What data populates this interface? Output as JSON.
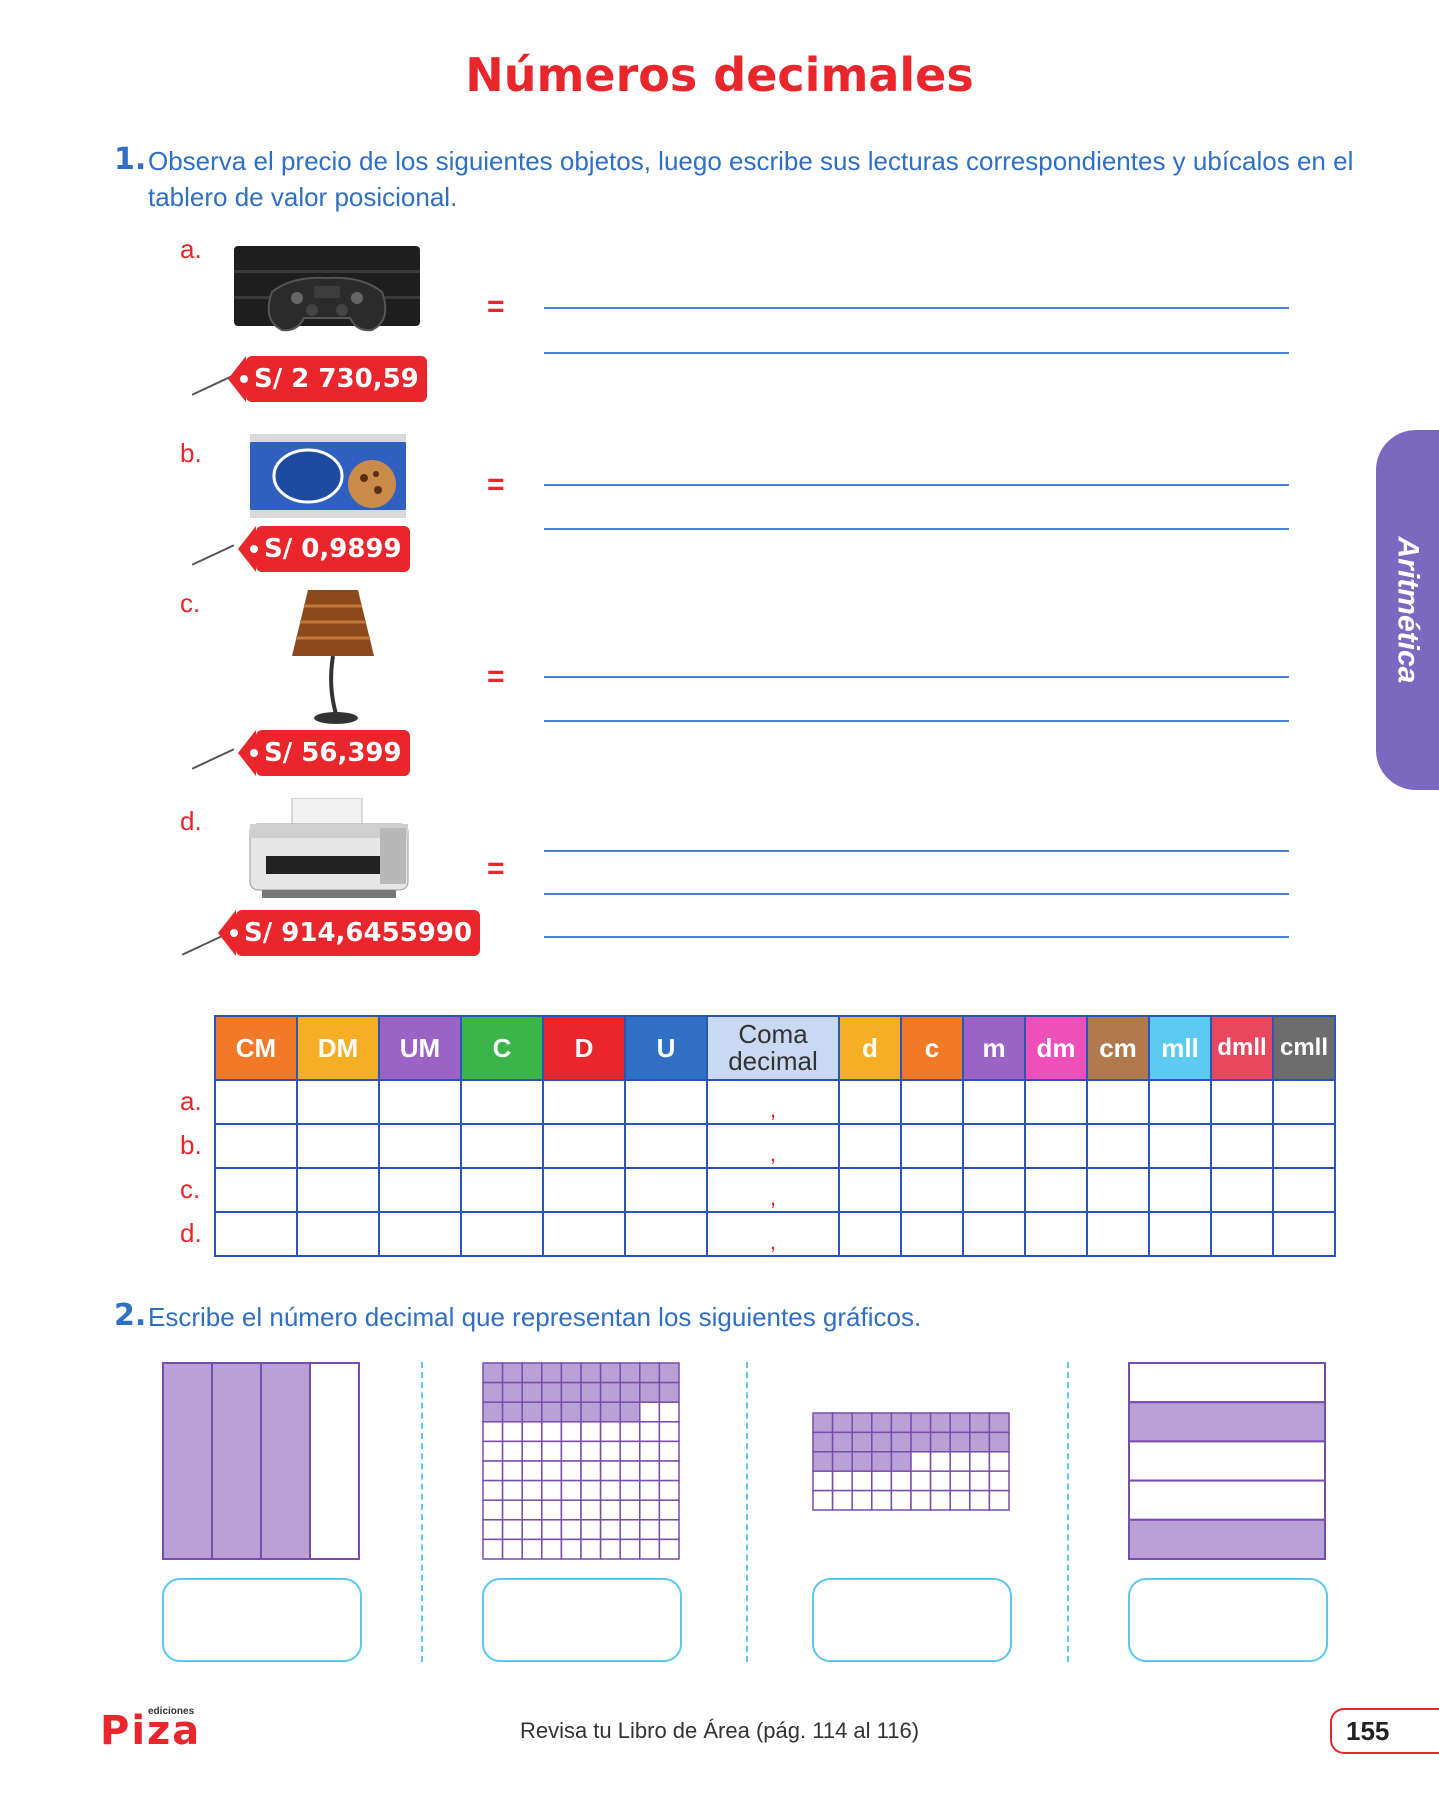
{
  "title": "Números decimales",
  "q1": {
    "number": "1.",
    "text": "Observa el precio de los siguientes objetos, luego escribe sus lecturas correspondientes y ubícalos en el tablero de valor posicional.",
    "items": [
      {
        "letter": "a.",
        "price": "S/ 2 730,59",
        "object_icon": "game-console-icon"
      },
      {
        "letter": "b.",
        "price": "S/ 0,9899",
        "object_icon": "cookies-package-icon"
      },
      {
        "letter": "c.",
        "price": "S/ 56,399",
        "object_icon": "lamp-icon"
      },
      {
        "letter": "d.",
        "price": "S/ 914,6455990",
        "object_icon": "printer-icon"
      }
    ],
    "equals": "="
  },
  "side_tab": {
    "label": "Aritmética"
  },
  "place_value_table": {
    "headers": [
      {
        "label": "CM",
        "color": "#f07a28"
      },
      {
        "label": "DM",
        "color": "#f6ae25"
      },
      {
        "label": "UM",
        "color": "#9b63c5"
      },
      {
        "label": "C",
        "color": "#3bb54a"
      },
      {
        "label": "D",
        "color": "#e8262b"
      },
      {
        "label": "U",
        "color": "#2f6fc4"
      },
      {
        "label": "Coma decimal",
        "color": "#c9d9f2"
      },
      {
        "label": "d",
        "color": "#f6ae25"
      },
      {
        "label": "c",
        "color": "#f07a28"
      },
      {
        "label": "m",
        "color": "#9b63c5"
      },
      {
        "label": "dm",
        "color": "#ee4fb8"
      },
      {
        "label": "cm",
        "color": "#b07a4e"
      },
      {
        "label": "mll",
        "color": "#5ccaf0"
      },
      {
        "label": "dmll",
        "color": "#e8485e"
      },
      {
        "label": "cmll",
        "color": "#6d6d6d"
      }
    ],
    "rows": [
      "a.",
      "b.",
      "c.",
      "d."
    ],
    "comma": ","
  },
  "q2": {
    "number": "2.",
    "text": "Escribe el número decimal que representan los siguientes gráficos.",
    "figures": [
      {
        "type": "columns",
        "parts": 4,
        "shaded": 3
      },
      {
        "type": "grid",
        "cols": 10,
        "rows": 10,
        "shaded": 28
      },
      {
        "type": "grid",
        "cols": 10,
        "rows": 5,
        "shaded": 25
      },
      {
        "type": "rows",
        "parts": 5,
        "shaded": 2
      }
    ],
    "shade_color": "#b9a1d6",
    "line_color": "#7b4cb0"
  },
  "footer": {
    "brand_small": "ediciones",
    "brand": "Piza",
    "text": "Revisa tu Libro de Área (pág. 114 al 116)",
    "page": "155"
  }
}
